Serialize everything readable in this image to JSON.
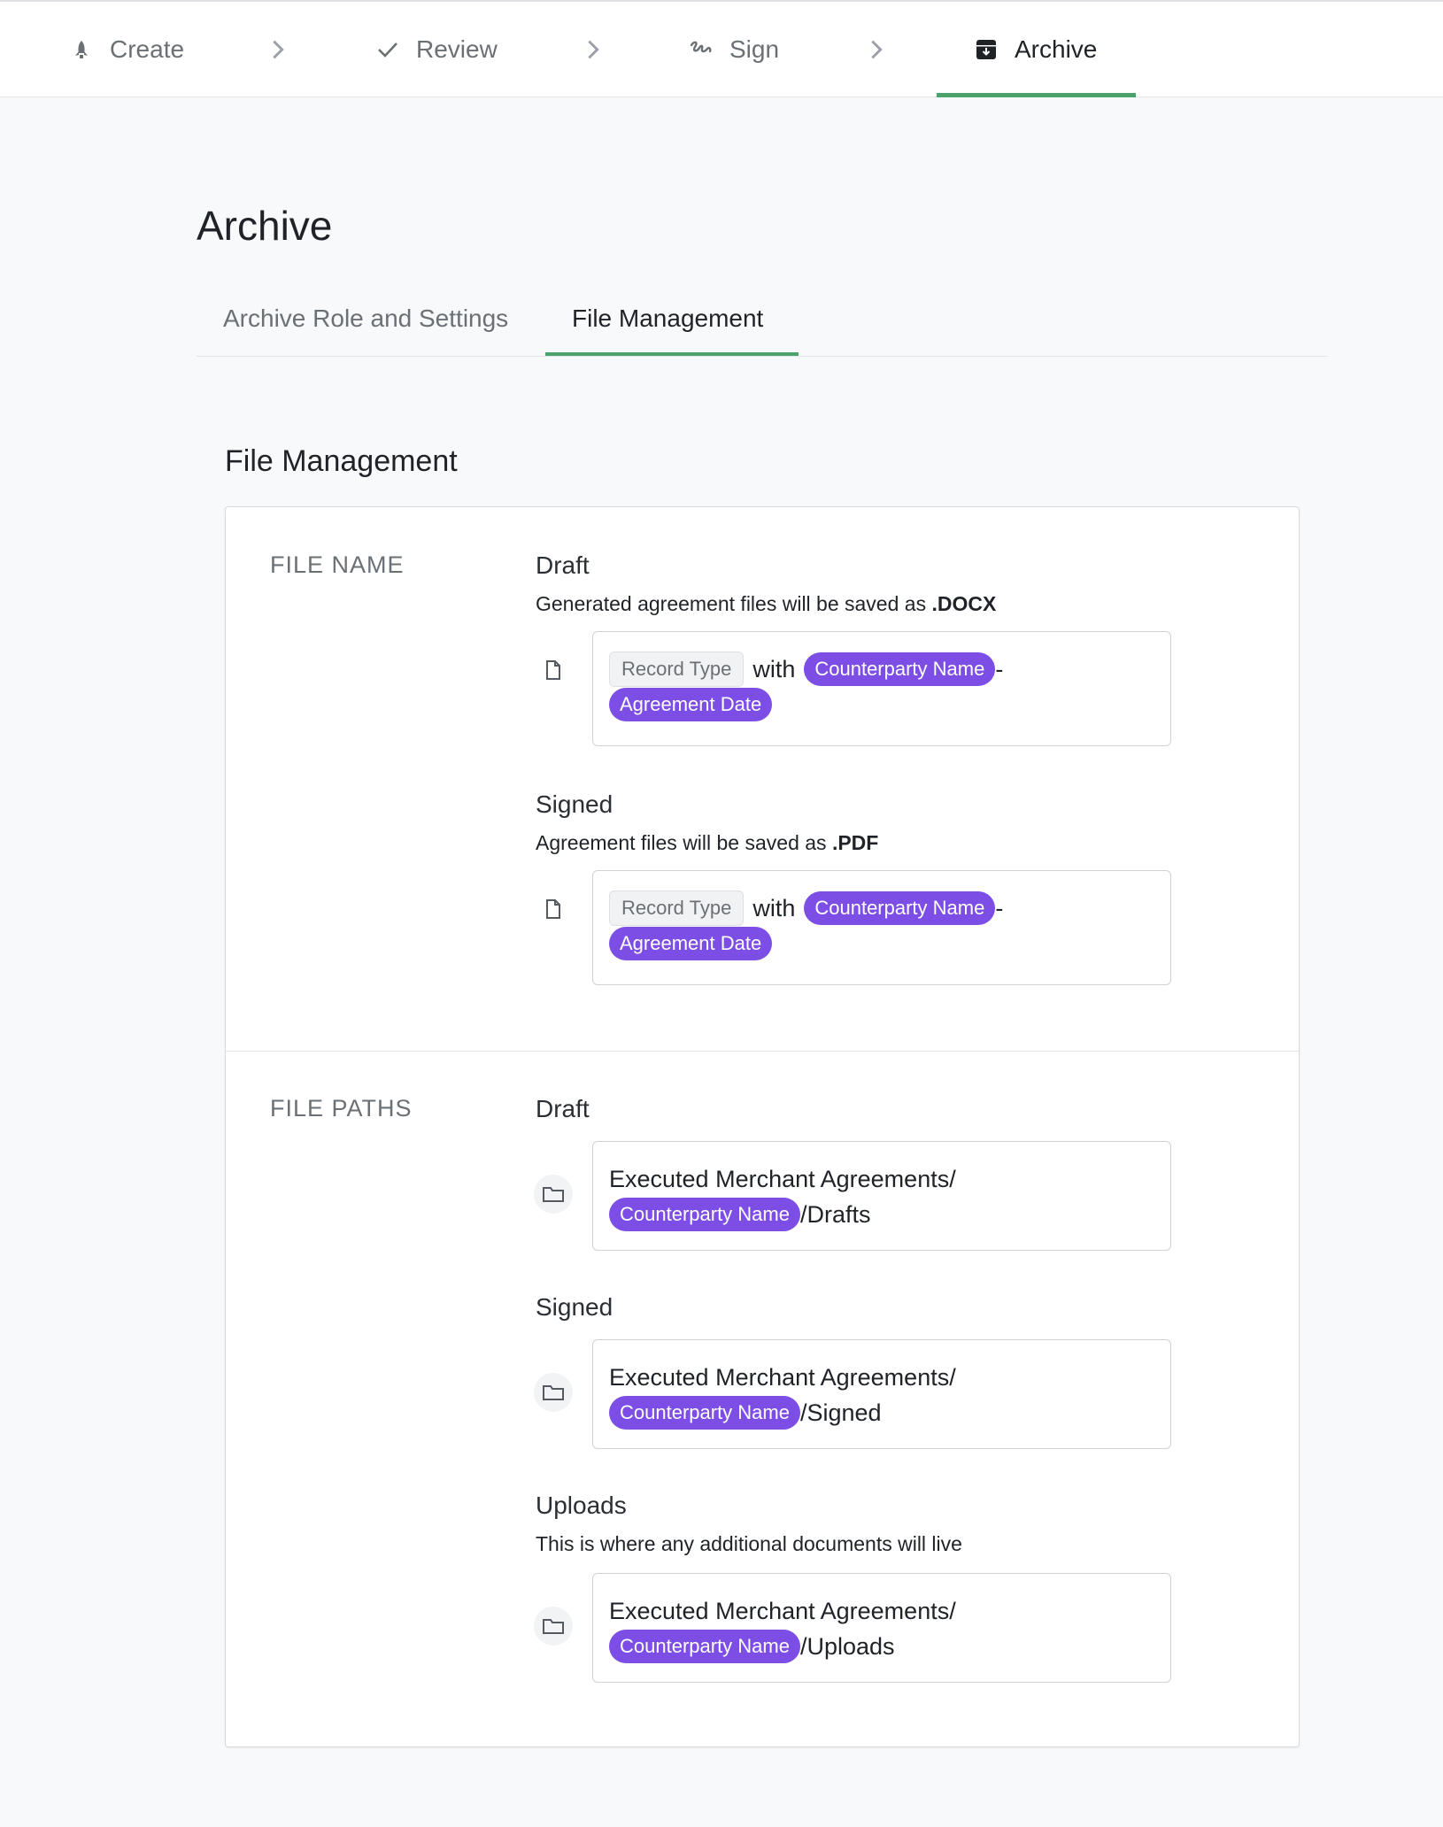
{
  "steps": [
    {
      "label": "Create",
      "icon": "rocket-icon"
    },
    {
      "label": "Review",
      "icon": "check-icon"
    },
    {
      "label": "Sign",
      "icon": "signature-icon"
    },
    {
      "label": "Archive",
      "icon": "archive-box-icon"
    }
  ],
  "active_step": "Archive",
  "page": {
    "title": "Archive"
  },
  "subtabs": [
    {
      "label": "Archive Role and Settings"
    },
    {
      "label": "File Management"
    }
  ],
  "section": {
    "title": "File Management",
    "file_name": {
      "label": "FILE NAME",
      "draft": {
        "title": "Draft",
        "desc_prefix": "Generated agreement files will be saved as",
        "desc_ext": ".DOCX",
        "tokens": {
          "record_type": "Record Type",
          "with": "with",
          "counterparty": "Counterparty Name",
          "dash": "-",
          "agreement_date": "Agreement Date"
        }
      },
      "signed": {
        "title": "Signed",
        "desc_prefix": "Agreement files will be saved as",
        "desc_ext": ".PDF",
        "tokens": {
          "record_type": "Record Type",
          "with": "with",
          "counterparty": "Counterparty Name",
          "dash": "-",
          "agreement_date": "Agreement Date"
        }
      }
    },
    "file_paths": {
      "label": "FILE PATHS",
      "draft": {
        "title": "Draft",
        "prefix": "Executed Merchant Agreements/",
        "counterparty": "Counterparty Name",
        "suffix": "/Drafts"
      },
      "signed": {
        "title": "Signed",
        "prefix": "Executed Merchant Agreements/",
        "counterparty": "Counterparty Name",
        "suffix": "/Signed"
      },
      "uploads": {
        "title": "Uploads",
        "desc": "This is where any additional documents will live",
        "prefix": "Executed Merchant Agreements/",
        "counterparty": "Counterparty Name",
        "suffix": "/Uploads"
      }
    }
  },
  "colors": {
    "accent_green": "#4aa36a",
    "chip_purple": "#7d4ee6"
  }
}
